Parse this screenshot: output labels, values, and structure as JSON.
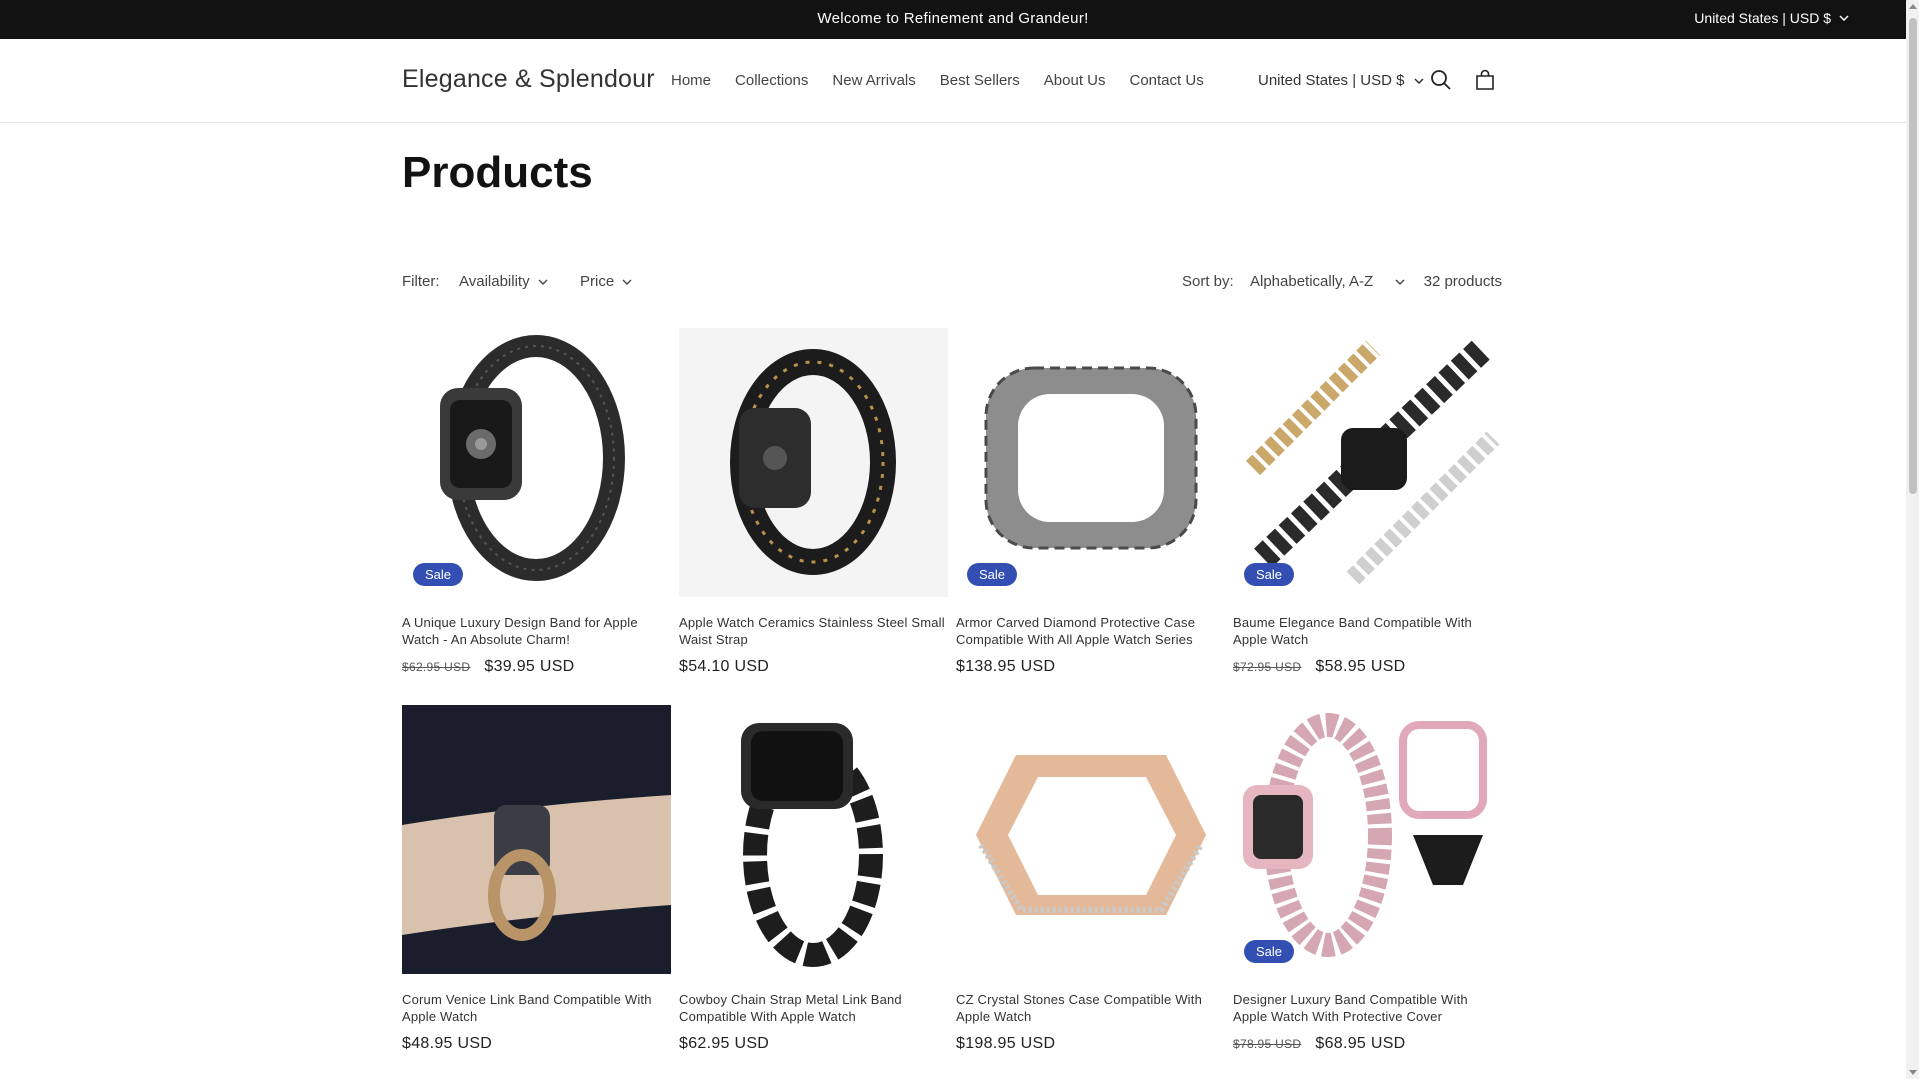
{
  "announcement": {
    "message": "Welcome to Refinement and Grandeur!",
    "locale": "United States | USD $"
  },
  "header": {
    "logo": "Elegance & Splendour",
    "nav": [
      "Home",
      "Collections",
      "New Arrivals",
      "Best Sellers",
      "About Us",
      "Contact Us"
    ],
    "locale": "United States | USD $",
    "icons": [
      "search-icon",
      "cart-icon"
    ]
  },
  "page": {
    "title": "Products"
  },
  "filters": {
    "label": "Filter:",
    "availability": "Availability",
    "price": "Price",
    "sort_label": "Sort by:",
    "sort_value": "Alphabetically, A-Z",
    "count": "32 products"
  },
  "products": [
    {
      "title": "A Unique Luxury Design Band for Apple Watch - An Absolute Charm!",
      "old_price": "$62.95 USD",
      "price": "$39.95 USD",
      "badge": "Sale"
    },
    {
      "title": "Apple Watch Ceramics Stainless Steel Small Waist Strap",
      "old_price": "",
      "price": "$54.10 USD",
      "badge": ""
    },
    {
      "title": "Armor Carved Diamond Protective Case Compatible With All Apple Watch Series",
      "old_price": "",
      "price": "$138.95 USD",
      "badge": "Sale"
    },
    {
      "title": "Baume Elegance Band Compatible With Apple Watch",
      "old_price": "$72.95 USD",
      "price": "$58.95 USD",
      "badge": "Sale"
    },
    {
      "title": "Corum Venice Link Band Compatible With Apple Watch",
      "old_price": "",
      "price": "$48.95 USD",
      "badge": ""
    },
    {
      "title": "Cowboy Chain Strap Metal Link Band Compatible With Apple Watch",
      "old_price": "",
      "price": "$62.95 USD",
      "badge": ""
    },
    {
      "title": "CZ Crystal Stones Case Compatible With Apple Watch",
      "old_price": "",
      "price": "$198.95 USD",
      "badge": ""
    },
    {
      "title": "Designer Luxury Band Compatible With Apple Watch With Protective Cover",
      "old_price": "$78.95 USD",
      "price": "$68.95 USD",
      "badge": "Sale"
    }
  ],
  "colors": {
    "announcement_bg": "#121212",
    "sale_badge": "#334fb4"
  }
}
